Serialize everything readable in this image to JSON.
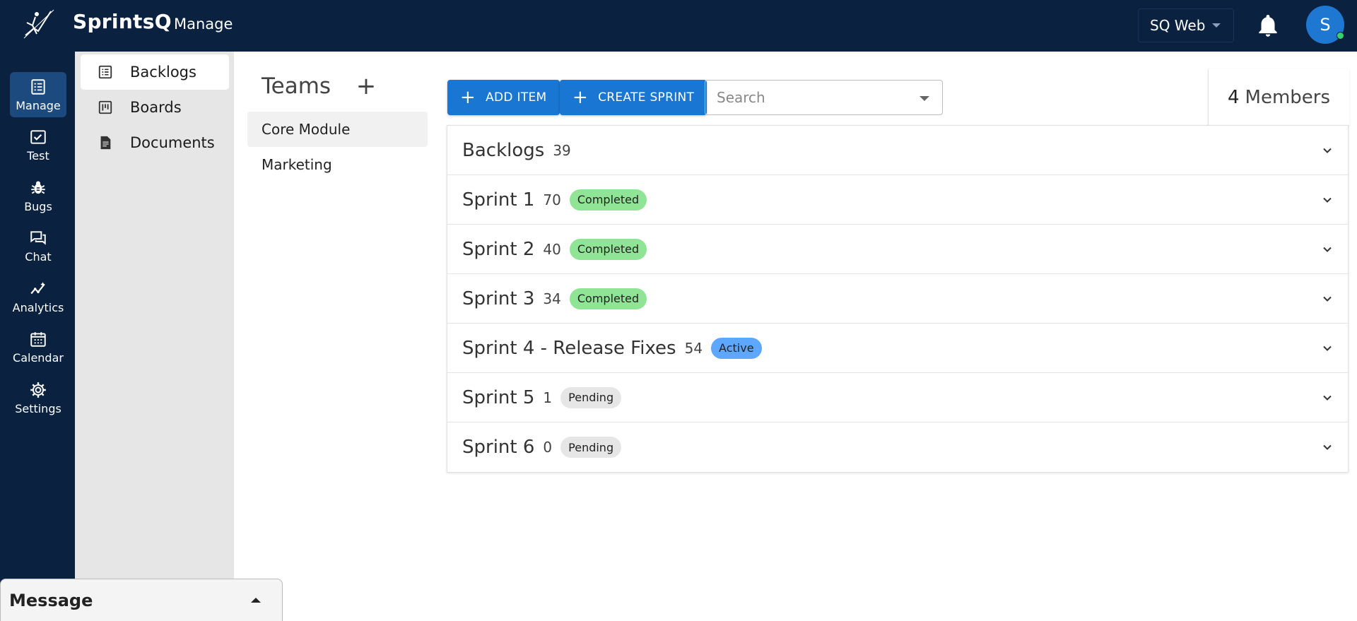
{
  "header": {
    "brand": "SprintsQ",
    "section": "Manage",
    "project": "SQ Web",
    "avatar_initial": "S"
  },
  "rail": {
    "items": [
      {
        "label": "Manage",
        "icon": "manage-icon",
        "active": true
      },
      {
        "label": "Test",
        "icon": "test-icon"
      },
      {
        "label": "Bugs",
        "icon": "bug-icon"
      },
      {
        "label": "Chat",
        "icon": "chat-icon"
      },
      {
        "label": "Analytics",
        "icon": "analytics-icon"
      },
      {
        "label": "Calendar",
        "icon": "calendar-icon"
      },
      {
        "label": "Settings",
        "icon": "settings-icon"
      }
    ]
  },
  "subnav": {
    "items": [
      {
        "label": "Backlogs",
        "icon": "backlog-icon",
        "active": true
      },
      {
        "label": "Boards",
        "icon": "board-icon"
      },
      {
        "label": "Documents",
        "icon": "document-icon"
      }
    ]
  },
  "teams": {
    "title": "Teams",
    "add": "+",
    "items": [
      {
        "label": "Core Module",
        "active": true
      },
      {
        "label": "Marketing"
      }
    ]
  },
  "toolbar": {
    "add_item": "ADD ITEM",
    "create_sprint": "CREATE SPRINT",
    "search_placeholder": "Search",
    "members_count": "4",
    "members_label": "Members"
  },
  "sprints": [
    {
      "name": "Backlogs",
      "count": "39",
      "status": ""
    },
    {
      "name": "Sprint 1",
      "count": "70",
      "status": "Completed"
    },
    {
      "name": "Sprint 2",
      "count": "40",
      "status": "Completed"
    },
    {
      "name": "Sprint 3",
      "count": "34",
      "status": "Completed"
    },
    {
      "name": "Sprint 4 - Release Fixes",
      "count": "54",
      "status": "Active"
    },
    {
      "name": "Sprint 5",
      "count": "1",
      "status": "Pending"
    },
    {
      "name": "Sprint 6",
      "count": "0",
      "status": "Pending"
    }
  ],
  "status_colors": {
    "Completed": "#90e495",
    "Active": "#5ea7ff",
    "Pending": "#e6e6e6"
  },
  "message": {
    "label": "Message"
  }
}
